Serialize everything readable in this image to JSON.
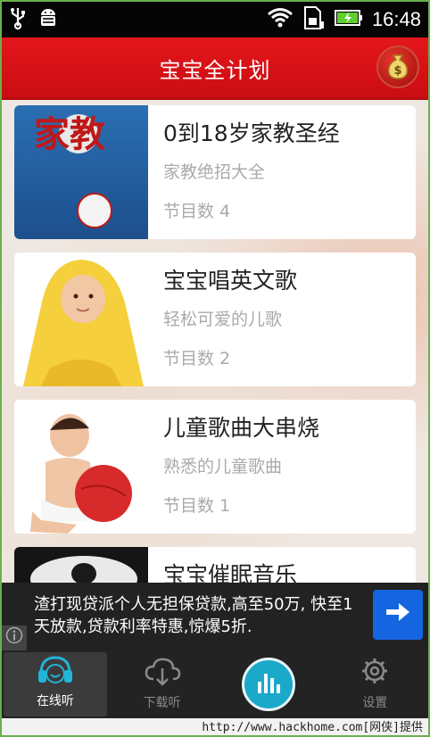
{
  "status_bar": {
    "time": "16:48",
    "icons": [
      "usb-icon",
      "android-debug-icon",
      "wifi-icon",
      "sim-card-icon",
      "battery-charging-icon"
    ]
  },
  "header": {
    "title": "宝宝全计划",
    "action_icon": "money-bag-icon"
  },
  "cards": [
    {
      "title": "0到18岁家教圣经",
      "subtitle": "家教绝招大全",
      "count": "节目数 4",
      "thumb_text": "家教"
    },
    {
      "title": "宝宝唱英文歌",
      "subtitle": "轻松可爱的儿歌",
      "count": "节目数 2"
    },
    {
      "title": "儿童歌曲大串烧",
      "subtitle": "熟悉的儿童歌曲",
      "count": "节目数 1"
    },
    {
      "title": "宝宝催眠音乐"
    }
  ],
  "ad": {
    "text": "渣打现贷派个人无担保贷款,高至50万, 快至1天放款,贷款利率特惠,惊爆5折.",
    "info_label": "i"
  },
  "nav": {
    "items": [
      {
        "label": "在线听",
        "icon": "headphones-icon",
        "active": true
      },
      {
        "label": "下载听",
        "icon": "cloud-download-icon",
        "active": false
      },
      {
        "label": "",
        "icon": "equalizer-play-icon",
        "active": false
      },
      {
        "label": "设置",
        "icon": "gear-icon",
        "active": false
      }
    ]
  },
  "footer": {
    "text": "http://www.hackhome.com[网侠]提供"
  },
  "colors": {
    "header_red": "#d41117",
    "accent_blue": "#1aa9c9",
    "ad_button_blue": "#1565e0"
  }
}
